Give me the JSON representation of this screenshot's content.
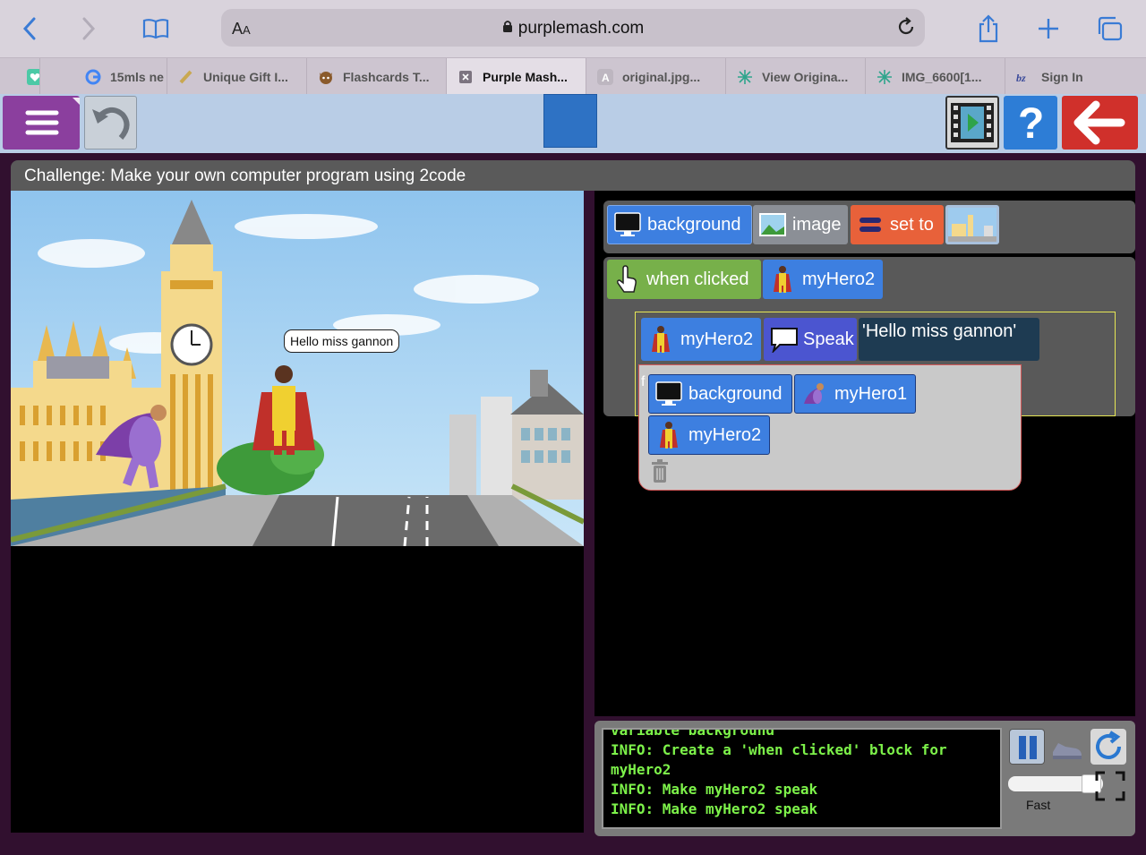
{
  "browser": {
    "domain": "purplemash.com",
    "aa_label": "AA",
    "tabs": [
      {
        "label": "",
        "icon": "heart-icon"
      },
      {
        "label": "15mls ne",
        "icon": "google-icon"
      },
      {
        "label": "Unique Gift I...",
        "icon": "gift-icon"
      },
      {
        "label": "Flashcards T...",
        "icon": "cat-icon"
      },
      {
        "label": "Purple Mash...",
        "icon": "close-icon",
        "active": true
      },
      {
        "label": "original.jpg...",
        "icon": "letter-a-icon"
      },
      {
        "label": "View Origina...",
        "icon": "sparkle-icon"
      },
      {
        "label": "IMG_6600[1...",
        "icon": "sparkle-icon"
      },
      {
        "label": "Sign In",
        "icon": "script-icon"
      }
    ]
  },
  "app": {
    "challenge": "Challenge: Make your own computer program using 2code",
    "speech_bubble": "Hello miss gannon",
    "blocks": {
      "row1": {
        "background": "background",
        "image": "image",
        "set_to": "set to"
      },
      "row2": {
        "when_clicked": "when clicked",
        "hero": "myHero2"
      },
      "row3": {
        "hero": "myHero2",
        "speak": "Speak",
        "text": "'Hello miss gannon'"
      },
      "menu": {
        "background": "background",
        "hero1": "myHero1",
        "hero2": "myHero2"
      }
    },
    "console_lines": [
      "variable background",
      "INFO: Create a 'when clicked' block for myHero2",
      "INFO: Make myHero2 speak",
      "INFO: Make myHero2 speak"
    ],
    "speed_label": "Fast"
  },
  "colors": {
    "purple_brand": "#8b3f9e",
    "console_text": "#7df24a",
    "block_blue": "#3d7fe0"
  }
}
